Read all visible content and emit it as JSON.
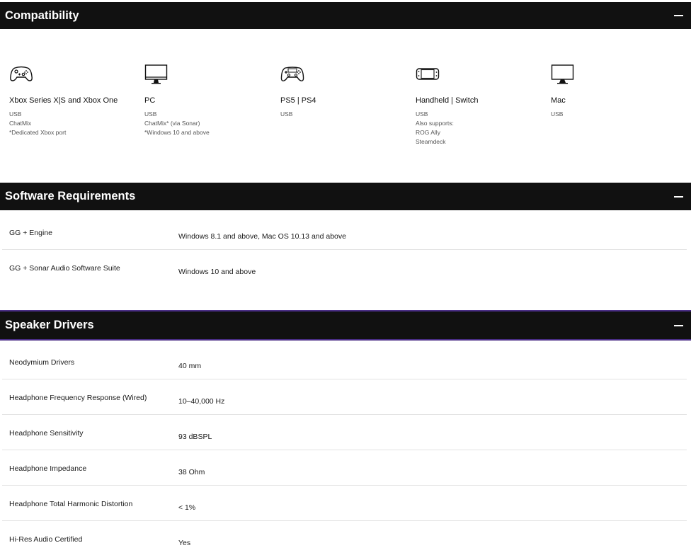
{
  "compatibility": {
    "title": "Compatibility",
    "devices": [
      {
        "icon": "xbox-controller-icon",
        "name": "Xbox Series X|S and Xbox One",
        "details": [
          "USB",
          "ChatMix",
          "*Dedicated Xbox port"
        ]
      },
      {
        "icon": "monitor-icon",
        "name": "PC",
        "details": [
          "USB",
          "ChatMix* (via Sonar)",
          "*Windows 10 and above"
        ]
      },
      {
        "icon": "playstation-controller-icon",
        "name": "PS5 | PS4",
        "details": [
          "USB"
        ]
      },
      {
        "icon": "handheld-console-icon",
        "name": "Handheld | Switch",
        "details": [
          "USB",
          "Also supports:",
          "ROG Ally",
          "Steamdeck"
        ]
      },
      {
        "icon": "mac-monitor-icon",
        "name": "Mac",
        "details": [
          "USB"
        ]
      }
    ]
  },
  "software": {
    "title": "Software Requirements",
    "rows": [
      {
        "label": "GG + Engine",
        "value": "Windows 8.1 and above, Mac OS 10.13 and above"
      },
      {
        "label": "GG + Sonar Audio Software Suite",
        "value": "Windows 10 and above"
      }
    ]
  },
  "speaker": {
    "title": "Speaker Drivers",
    "rows": [
      {
        "label": "Neodymium Drivers",
        "value": "40 mm"
      },
      {
        "label": "Headphone Frequency Response (Wired)",
        "value": "10–40,000 Hz"
      },
      {
        "label": "Headphone Sensitivity",
        "value": "93 dBSPL"
      },
      {
        "label": "Headphone Impedance",
        "value": "38 Ohm"
      },
      {
        "label": "Headphone Total Harmonic Distortion",
        "value": "< 1%"
      },
      {
        "label": "Hi-Res Audio Certified",
        "value": "Yes"
      }
    ]
  },
  "colors": {
    "header_bg": "#111111",
    "accent_border": "#4a2e86"
  }
}
